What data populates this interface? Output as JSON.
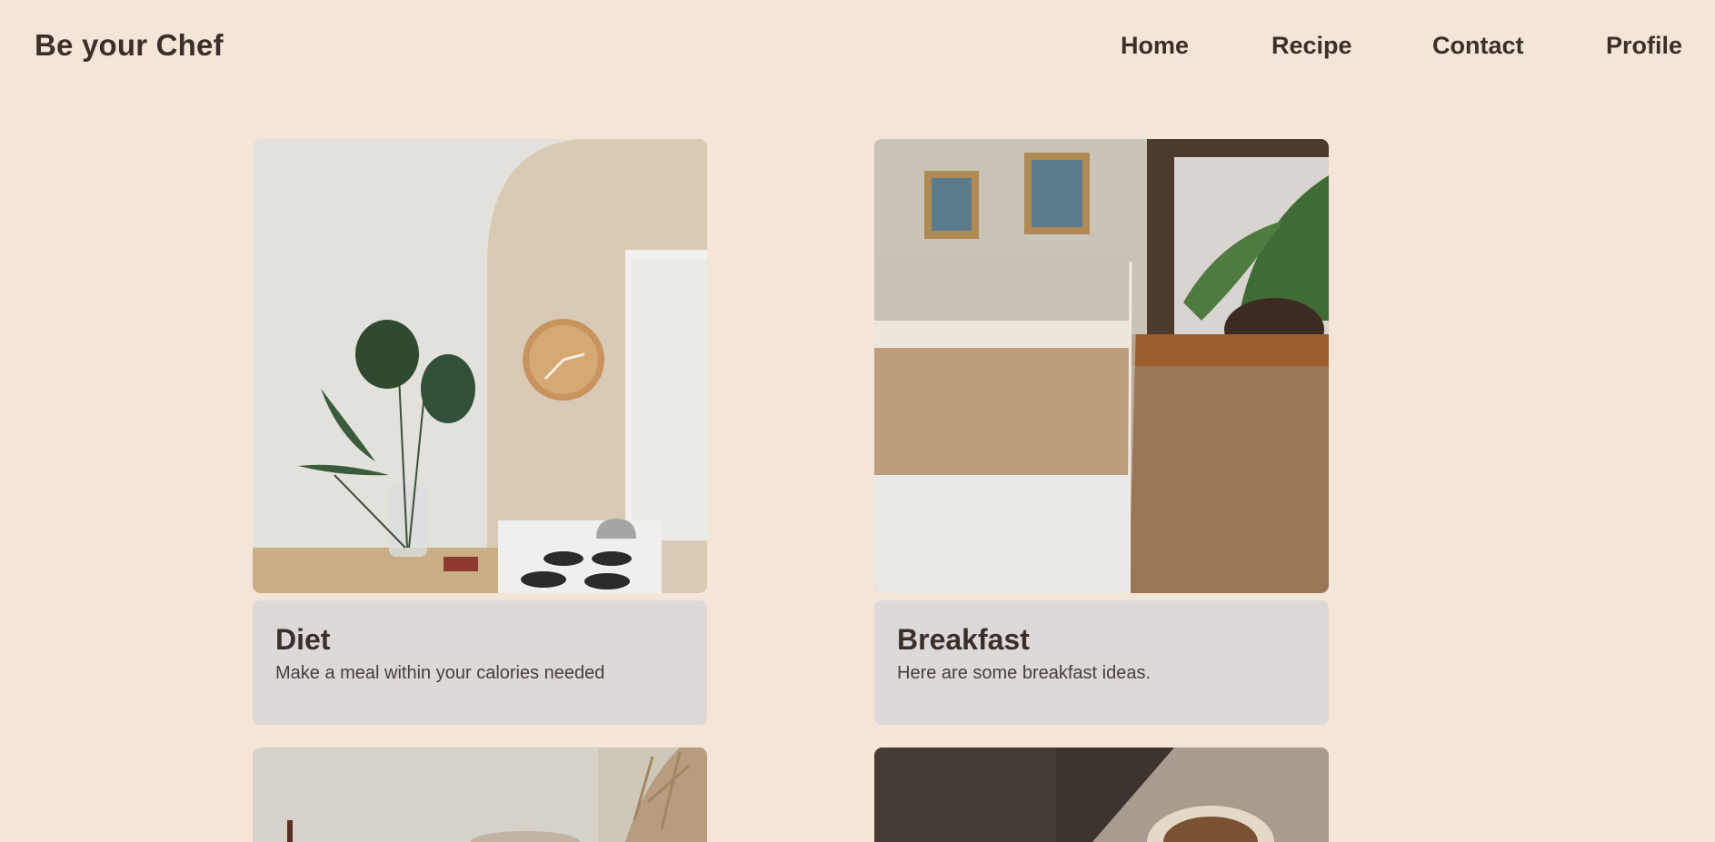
{
  "header": {
    "brand": "Be your Chef",
    "nav": [
      "Home",
      "Recipe",
      "Contact",
      "Profile"
    ]
  },
  "cards": [
    {
      "title": "Diet",
      "description": "Make a meal within your calories needed",
      "image": "kitchen-plant-clock-photo"
    },
    {
      "title": "Breakfast",
      "description": "Here are some breakfast ideas.",
      "image": "iced-coffee-glass-photo"
    },
    {
      "image": "table-dried-flowers-photo"
    },
    {
      "image": "coffee-cup-on-table-photo"
    }
  ],
  "colors": {
    "background": "#f3e5d7",
    "card_body": "#dcd9d8",
    "text_dark": "#3b3029"
  }
}
